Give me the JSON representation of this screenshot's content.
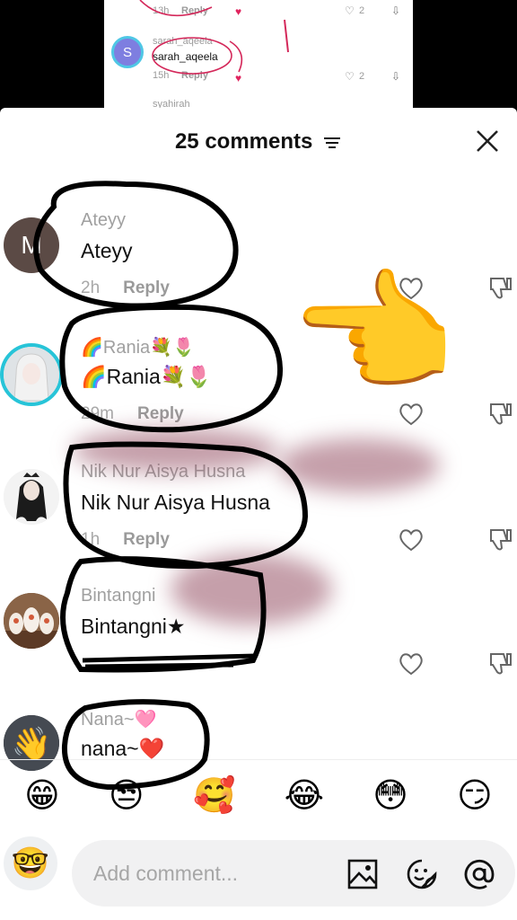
{
  "background_screenshot": {
    "row1": {
      "time": "13h",
      "reply": "Reply",
      "likes": "2"
    },
    "row2": {
      "avatar_letter": "S",
      "username": "sarah_aqeela",
      "text": "sarah_aqeela",
      "time": "15h",
      "reply": "Reply",
      "likes": "2"
    },
    "row3": {
      "username": "syahirah"
    }
  },
  "header": {
    "title": "25 comments"
  },
  "comments": [
    {
      "username": "Ateyy",
      "text": "Ateyy",
      "time": "2h",
      "reply": "Reply",
      "avatar_letter": "M"
    },
    {
      "username": "🌈Rania💐🌷",
      "text": "🌈Rania💐🌷",
      "time": "29m",
      "reply": "Reply",
      "avatar": "girl-avatar"
    },
    {
      "username": "Nik Nur Aisya Husna",
      "text": "Nik Nur Aisya Husna",
      "time": "1h",
      "reply": "Reply",
      "avatar": "hair-avatar"
    },
    {
      "username": "Bintangni",
      "text": "Bintangni★",
      "avatar": "figurines-avatar"
    },
    {
      "username": "Nana~🩷",
      "text": "nana~❤️",
      "avatar": "wave-avatar"
    }
  ],
  "emoji_bar": [
    "😁",
    "😒",
    "🥰",
    "😂",
    "😳",
    "😏"
  ],
  "composer": {
    "placeholder": "Add comment...",
    "avatar": "🤓"
  },
  "sticker": "👉",
  "colors": {
    "annotation": "#000000",
    "accent_ring": "#4fc7e5"
  }
}
